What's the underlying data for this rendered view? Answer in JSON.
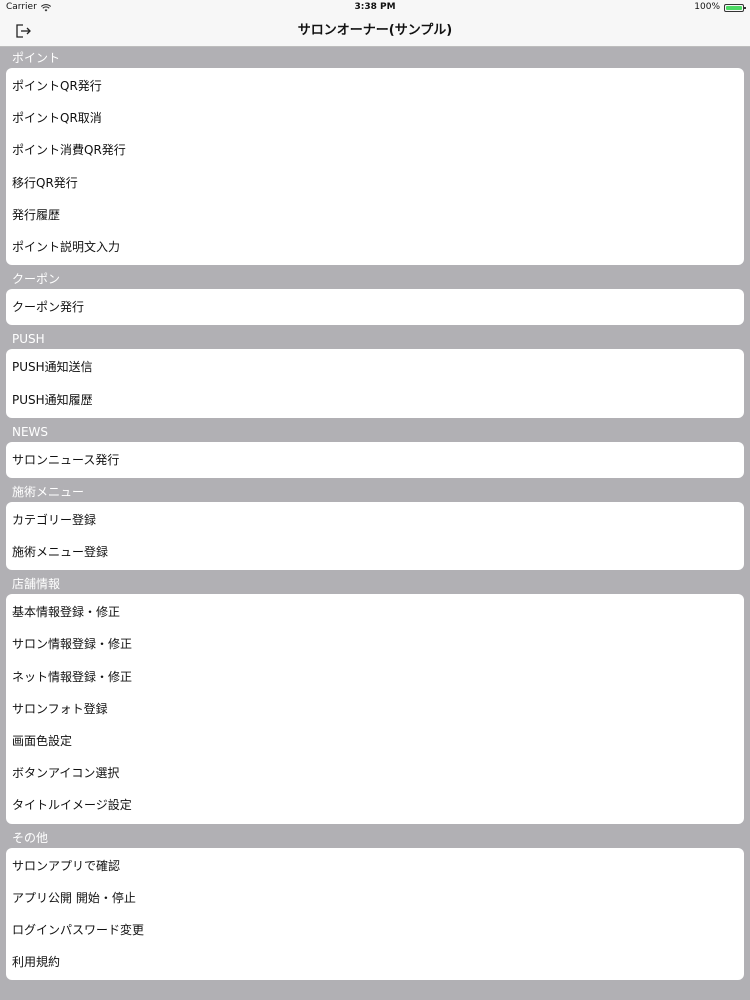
{
  "status_bar": {
    "carrier": "Carrier",
    "time": "3:38 PM",
    "battery": "100%"
  },
  "nav": {
    "title": "サロンオーナー(サンプル)",
    "logout_icon": "logout-icon"
  },
  "sections": [
    {
      "header": "ポイント",
      "items": [
        "ポイントQR発行",
        "ポイントQR取消",
        "ポイント消費QR発行",
        "移行QR発行",
        "発行履歴",
        "ポイント説明文入力"
      ]
    },
    {
      "header": "クーポン",
      "items": [
        "クーポン発行"
      ]
    },
    {
      "header": "PUSH",
      "items": [
        "PUSH通知送信",
        "PUSH通知履歴"
      ]
    },
    {
      "header": "NEWS",
      "items": [
        "サロンニュース発行"
      ]
    },
    {
      "header": "施術メニュー",
      "items": [
        "カテゴリー登録",
        "施術メニュー登録"
      ]
    },
    {
      "header": "店舗情報",
      "items": [
        "基本情報登録・修正",
        "サロン情報登録・修正",
        "ネット情報登録・修正",
        "サロンフォト登録",
        "画面色設定",
        "ボタンアイコン選択",
        "タイトルイメージ設定"
      ]
    },
    {
      "header": "その他",
      "items": [
        "サロンアプリで確認",
        "アプリ公開 開始・停止",
        "ログインパスワード変更",
        "利用規約"
      ]
    }
  ]
}
